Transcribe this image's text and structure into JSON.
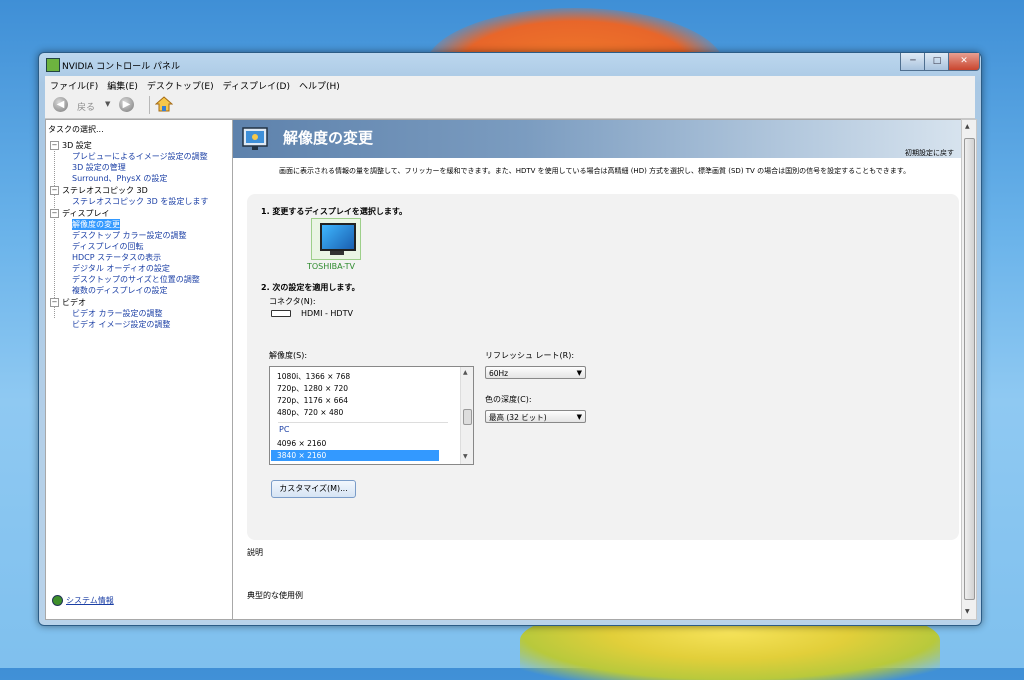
{
  "window": {
    "title": "NVIDIA コントロール パネル",
    "controls": {
      "minimize": "─",
      "maximize": "□",
      "close": "✕"
    }
  },
  "menu": [
    "ファイル(F)",
    "編集(E)",
    "デスクトップ(E)",
    "ディスプレイ(D)",
    "ヘルプ(H)"
  ],
  "toolbar": {
    "back_label": "戻る",
    "back_icon": "back-arrow-icon",
    "forward_icon": "forward-arrow-icon",
    "home_icon": "home-icon"
  },
  "left": {
    "task_label": "タスクの選択...",
    "categories": [
      {
        "label": "3D 設定",
        "items": [
          "プレビューによるイメージ設定の調整",
          "3D 設定の管理",
          "Surround、PhysX の設定"
        ]
      },
      {
        "label": "ステレオスコピック 3D",
        "items": [
          "ステレオスコピック 3D を設定します"
        ]
      },
      {
        "label": "ディスプレイ",
        "items": [
          "解像度の変更",
          "デスクトップ カラー設定の調整",
          "ディスプレイの回転",
          "HDCP ステータスの表示",
          "デジタル オーディオの設定",
          "デスクトップのサイズと位置の調整",
          "複数のディスプレイの設定"
        ]
      },
      {
        "label": "ビデオ",
        "items": [
          "ビデオ カラー設定の調整",
          "ビデオ イメージ設定の調整"
        ]
      }
    ],
    "selected": "解像度の変更",
    "system_info": "システム情報"
  },
  "main": {
    "title": "解像度の変更",
    "restore_defaults": "初期設定に戻す",
    "intro": "画面に表示される情報の量を調整して、フリッカーを緩和できます。また、HDTV を使用している場合は高精細 (HD) 方式を選択し、標準画質 (SD) TV の場合は国別の信号を設定することもできます。",
    "step1": "1. 変更するディスプレイを選択します。",
    "display_name": "TOSHIBA-TV",
    "step2": "2. 次の設定を適用します。",
    "connector_label": "コネクタ(N):",
    "connector_value": "HDMI - HDTV",
    "resolution_label": "解像度(S):",
    "resolution_items": [
      "1080i、1366 × 768",
      "720p、1280 × 720",
      "720p、1176 × 664",
      "480p、720 × 480"
    ],
    "pc_group": "PC",
    "pc_items": [
      "4096 × 2160",
      "3840 × 2160"
    ],
    "selected_resolution": "3840 × 2160",
    "refresh_label": "リフレッシュ レート(R):",
    "refresh_value": "60Hz",
    "color_depth_label": "色の深度(C):",
    "color_depth_value": "最高 (32 ビット)",
    "customize_button": "カスタマイズ(M)...",
    "description_label": "説明",
    "usage_label": "典型的な使用例"
  },
  "colors": {
    "accent": "#3399ff",
    "link": "#1b3fa5",
    "banner": "#6b8fb8"
  }
}
